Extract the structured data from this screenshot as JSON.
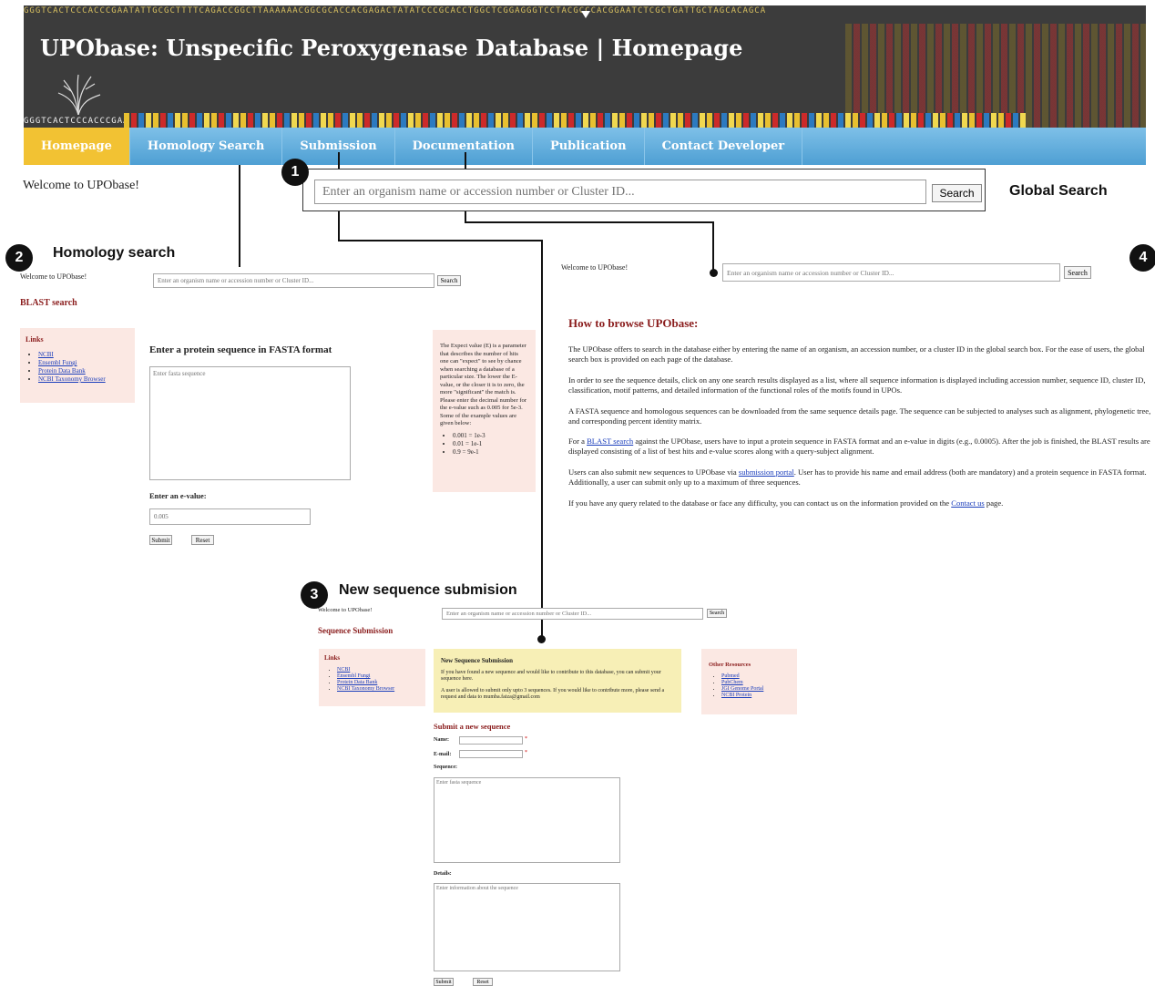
{
  "banner": {
    "title": "UPObase: Unspecific Peroxygenase Database | Homepage",
    "sequence_text": "GGGTCACTCCCACCCGAATATTGCGCTTTTCAGACCGGCTTAAAAAACGGCGCACCACGAGACTATATCCCGCACCTGGCTCGGAGGGTCCTACGCCCACGGAATCTCGCTGATTGCTAGCACAGCA"
  },
  "nav": {
    "items": [
      "Homepage",
      "Homology Search",
      "Submission",
      "Documentation",
      "Publication",
      "Contact Developer"
    ],
    "active": "Homepage"
  },
  "global": {
    "welcome": "Welcome to UPObase!",
    "placeholder": "Enter an organism name or accession number or Cluster ID...",
    "search_label": "Search",
    "annotation": "Global Search"
  },
  "callouts": {
    "n1": "1",
    "n2": "2",
    "n3": "3",
    "n4": "4",
    "homology": "Homology search",
    "submission": "New sequence submision"
  },
  "homology": {
    "welcome": "Welcome to UPObase!",
    "placeholder": "Enter an organism name or accession number or Cluster ID...",
    "search_label": "Search",
    "heading": "BLAST search",
    "links_title": "Links",
    "links": [
      "NCBI",
      "Ensembl Fungi",
      "Protein Data Bank",
      "NCBI Taxonomy Browser"
    ],
    "fasta_heading": "Enter a protein sequence in FASTA format",
    "fasta_placeholder": "Enter fasta sequence",
    "evalue_label": "Enter an e-value:",
    "evalue_value": "0.005",
    "submit_label": "Submit",
    "reset_label": "Reset",
    "help_text": "The Expect value (E) is a parameter that describes the number of hits one can \"expect\" to see by chance when searching a database of a particular size. The lower the E-value, or the closer it is to zero, the more \"significant\" the match is. Please enter the decimal number for the e-value such as 0.005 for 5e-3. Some of the example values are given below:",
    "examples": [
      "0.001 = 1e-3",
      "0.01 = 1e-1",
      "0.9 = 9e-1"
    ]
  },
  "submission": {
    "welcome": "Welcome to UPObase!",
    "placeholder": "Enter an organism name or accession number or Cluster ID...",
    "search_label": "Search",
    "heading": "Sequence Submission",
    "links_title": "Links",
    "links": [
      "NCBI",
      "Ensembl Fungi",
      "Protein Data Bank",
      "NCBI Taxonomy Browser"
    ],
    "notice_title": "New Sequence Submission",
    "notice_p1": "If you have found a new sequence and would like to contribute to this database, you can submit your sequence here.",
    "notice_p2": "A user is allowed to submit only upto 3 sequences. If you would like to contribute more, please send a request and data to mumba.faiza@gmail.com",
    "other_title": "Other Resources",
    "other_links": [
      "Pubmed",
      "PubChem",
      "JGI Genome Portal",
      "NCBI Protein"
    ],
    "form_heading": "Submit a new sequence",
    "name_label": "Name:",
    "email_label": "E-mail:",
    "sequence_label": "Sequence:",
    "sequence_placeholder": "Enter fasta sequence",
    "details_label": "Details:",
    "details_placeholder": "Enter information about the sequence",
    "submit_label": "Submit",
    "reset_label": "Reset",
    "required_mark": "*"
  },
  "browse": {
    "welcome": "Welcome to UPObase!",
    "placeholder": "Enter an organism name or accession number or Cluster ID...",
    "search_label": "Search",
    "heading": "How to browse UPObase:",
    "p1": "The UPObase offers to search in the database either by entering the name of an organism, an accession number, or a cluster ID in the global search box. For the ease of users, the global search box is provided on each page of the database.",
    "p2": "In order to see the sequence details, click on any one search results displayed as a list, where all sequence information is displayed including accession number, sequence ID, cluster ID, classification, motif patterns, and detailed information of the functional roles of the motifs found in UPOs.",
    "p3": "A FASTA sequence and homologous sequences can be downloaded from the same sequence details page. The sequence can be subjected to analyses such as alignment, phylogenetic tree, and corresponding percent identity matrix.",
    "p4_pre": "For a ",
    "p4_link": "BLAST search",
    "p4_post": " against the UPObase, users have to input a protein sequence in FASTA format and an e-value in digits (e.g., 0.0005). After the job is finished, the BLAST results are displayed consisting of a list of best hits and e-value scores along with a query-subject alignment.",
    "p5_pre": "Users can also submit new sequences to UPObase via ",
    "p5_link": "submission portal",
    "p5_post": ". User has to provide his name and email address (both are mandatory) and a protein sequence in FASTA format. Additionally, a user can submit only up to a maximum of three sequences.",
    "p6_pre": "If you have any query related to the database or face any difficulty, you can contact us on the information provided on the ",
    "p6_link": "Contact us",
    "p6_post": " page."
  }
}
